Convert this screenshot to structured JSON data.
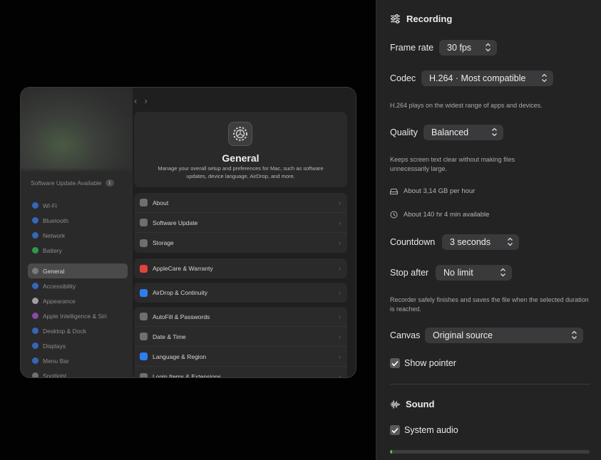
{
  "preview": {
    "software_update": "Software Update Available",
    "update_count": "1",
    "sidebar": [
      {
        "label": "Wi-Fi",
        "color": "#3b82f6"
      },
      {
        "label": "Bluetooth",
        "color": "#3b82f6"
      },
      {
        "label": "Network",
        "color": "#3b82f6"
      },
      {
        "label": "Battery",
        "color": "#34c759"
      },
      {
        "label": "General",
        "color": "#8e8e93",
        "selected": true
      },
      {
        "label": "Accessibility",
        "color": "#3b82f6"
      },
      {
        "label": "Appearance",
        "color": "#d1d1d6"
      },
      {
        "label": "Apple Intelligence & Siri",
        "color": "#b05bd6"
      },
      {
        "label": "Desktop & Dock",
        "color": "#3b82f6"
      },
      {
        "label": "Displays",
        "color": "#3b82f6"
      },
      {
        "label": "Menu Bar",
        "color": "#3b82f6"
      },
      {
        "label": "Spotlight",
        "color": "#8e8e93"
      }
    ],
    "general": {
      "title": "General",
      "description": "Manage your overall setup and preferences for Mac, such as software updates, device language, AirDrop, and more."
    },
    "groups": [
      [
        {
          "label": "About",
          "color": "#6e6e73"
        },
        {
          "label": "Software Update",
          "color": "#6e6e73"
        },
        {
          "label": "Storage",
          "color": "#6e6e73"
        }
      ],
      [
        {
          "label": "AppleCare & Warranty",
          "color": "#e0443a"
        }
      ],
      [
        {
          "label": "AirDrop & Continuity",
          "color": "#2f7ef0"
        }
      ],
      [
        {
          "label": "AutoFill & Passwords",
          "color": "#6e6e73"
        },
        {
          "label": "Date & Time",
          "color": "#6e6e73"
        },
        {
          "label": "Language & Region",
          "color": "#2f7ef0"
        },
        {
          "label": "Login Items & Extensions",
          "color": "#6e6e73"
        }
      ]
    ]
  },
  "panel": {
    "recording_title": "Recording",
    "frame_rate_label": "Frame rate",
    "frame_rate_value": "30 fps",
    "codec_label": "Codec",
    "codec_value": "H.264 · Most compatible",
    "codec_hint": "H.264 plays on the widest range of apps and devices.",
    "quality_label": "Quality",
    "quality_value": "Balanced",
    "quality_hint": "Keeps screen text clear without making files unnecessarily large.",
    "size_info": "About 3,14 GB per hour",
    "time_info": "About 140 hr 4 min available",
    "countdown_label": "Countdown",
    "countdown_value": "3 seconds",
    "stop_after_label": "Stop after",
    "stop_after_value": "No limit",
    "stop_hint": "Recorder safely finishes and saves the file when the selected duration is reached.",
    "canvas_label": "Canvas",
    "canvas_value": "Original source",
    "show_pointer_label": "Show pointer",
    "show_pointer_checked": true,
    "sound_title": "Sound",
    "system_audio_label": "System audio",
    "system_audio_checked": true,
    "audio_level": 0.01,
    "accent_color": "#4cc05a"
  }
}
